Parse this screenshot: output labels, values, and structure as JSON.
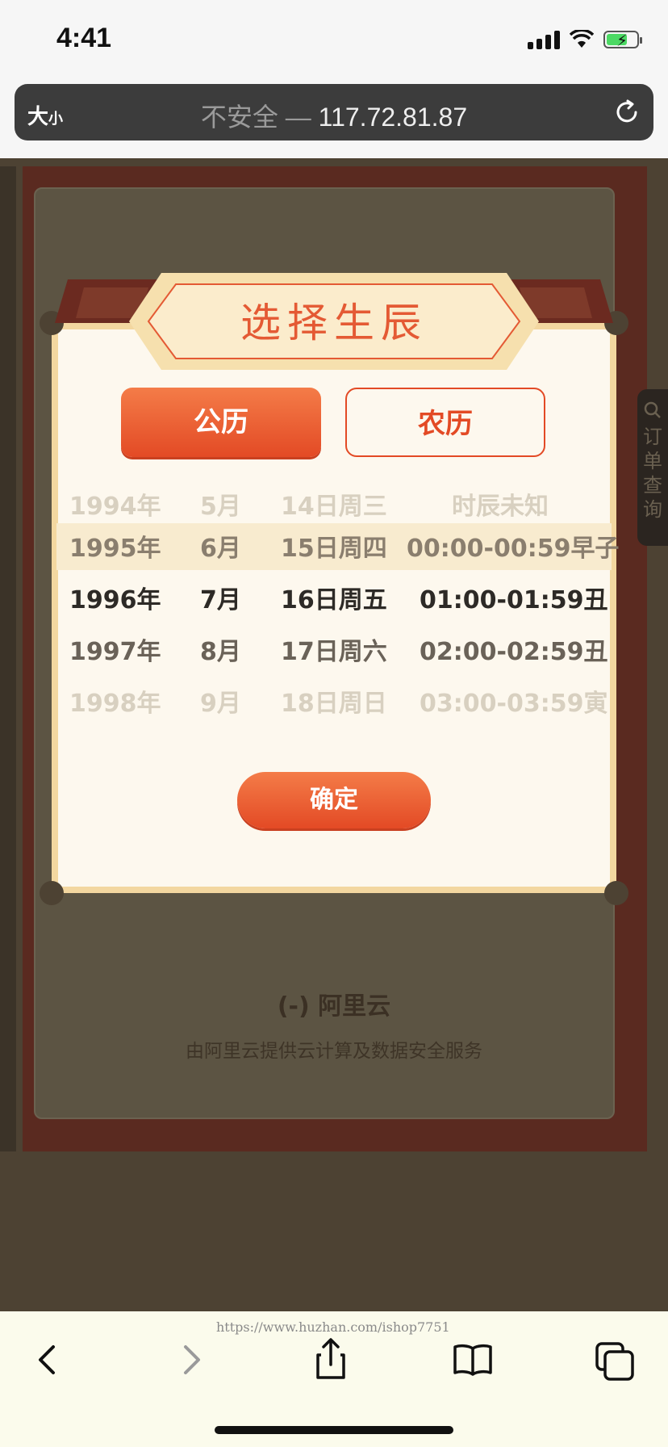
{
  "status_bar": {
    "time": "4:41",
    "battery_level": 0.7,
    "colors": {
      "battery": "#4cd964"
    }
  },
  "address_bar": {
    "text_size_label_big": "大",
    "text_size_label_small": "小",
    "insecure_label": "不安全 —",
    "host": "117.72.81.87"
  },
  "background_page": {
    "logo_text": "(-) 阿里云",
    "footer_text": "由阿里云提供云计算及数据安全服务",
    "side_tab_label": "订单查询"
  },
  "modal": {
    "title": "选择生辰",
    "tabs": [
      {
        "label": "公历",
        "active": true
      },
      {
        "label": "农历",
        "active": false
      }
    ],
    "picker_rows": [
      {
        "year": "1994年",
        "month": "5月",
        "day": "14日周三",
        "hour": "时辰未知"
      },
      {
        "year": "1995年",
        "month": "6月",
        "day": "15日周四",
        "hour": "00:00-00:59早子"
      },
      {
        "year": "1996年",
        "month": "7月",
        "day": "16日周五",
        "hour": "01:00-01:59丑"
      },
      {
        "year": "1997年",
        "month": "8月",
        "day": "17日周六",
        "hour": "02:00-02:59丑"
      },
      {
        "year": "1998年",
        "month": "9月",
        "day": "18日周日",
        "hour": "03:00-03:59寅"
      }
    ],
    "confirm_label": "确定",
    "colors": {
      "accent": "#e34a25",
      "title": "#e45a34",
      "border": "#f3d7a0"
    }
  },
  "toolbar": {
    "watermark": "https://www.huzhan.com/ishop7751"
  }
}
